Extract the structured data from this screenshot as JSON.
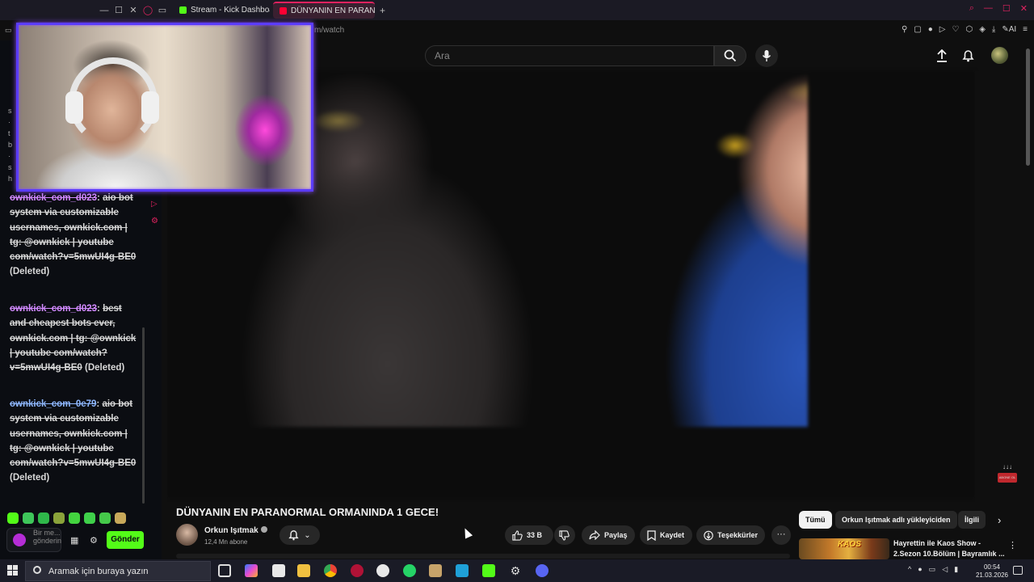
{
  "browser": {
    "tabs": [
      {
        "label": "Stream - Kick Dashboard",
        "favicon_color": "#53fc18",
        "active": false
      },
      {
        "label": "DÜNYANIN EN PARAN",
        "favicon_color": "#ff0033",
        "active": true
      }
    ],
    "new_tab": "+",
    "address": "m/watch"
  },
  "youtube": {
    "search_placeholder": "Ara",
    "video_title": "DÜNYANIN EN PARANORMAL ORMANINDA 1 GECE!",
    "channel_name": "Orkun Işıtmak",
    "subscribers": "12,4 Mn abone",
    "likes": "33 B",
    "share_label": "Paylaş",
    "save_label": "Kaydet",
    "thanks_label": "Teşekkürler",
    "more_label": "···",
    "chips": [
      {
        "label": "Tümü",
        "active": true
      },
      {
        "label": "Orkun Işıtmak adlı yükleyiciden",
        "active": false
      },
      {
        "label": "İlgili",
        "active": false
      }
    ],
    "recommendation": {
      "thumb_text": "KAOS",
      "title": "Hayrettin ile Kaos Show - 2.Sezon 10.Bölüm | Bayramlık ..."
    },
    "subscribe_badge": "ABONE OL"
  },
  "chat": {
    "messages": [
      {
        "user": "ownkick_com_d023",
        "text": "aio bot system via customizable usernames, ownkick.com | tg: @ownkick | youtube com/watch?v=5mwUI4g-BE0",
        "deleted": "(Deleted)"
      },
      {
        "user": "ownkick_com_d023",
        "text": "best and cheapest bots ever, ownkick.com | tg: @ownkick | youtube com/watch?v=5mwUI4g-BE0",
        "deleted": "(Deleted)"
      },
      {
        "user": "ownkick_com_0e79",
        "text": "aio bot system via customizable usernames, ownkick.com | tg: @ownkick | youtube com/watch?v=5mwUI4g-BE0",
        "deleted": "(Deleted)"
      }
    ],
    "input_placeholder": "Bir me... gönderin",
    "send_label": "Gönder"
  },
  "taskbar": {
    "search_placeholder": "Aramak için buraya yazın",
    "time": "00:54",
    "date": "21.03.2026"
  },
  "colors": {
    "kick_green": "#53fc18",
    "accent_pink": "#e0225f",
    "cam_border": "#5b3cff"
  }
}
